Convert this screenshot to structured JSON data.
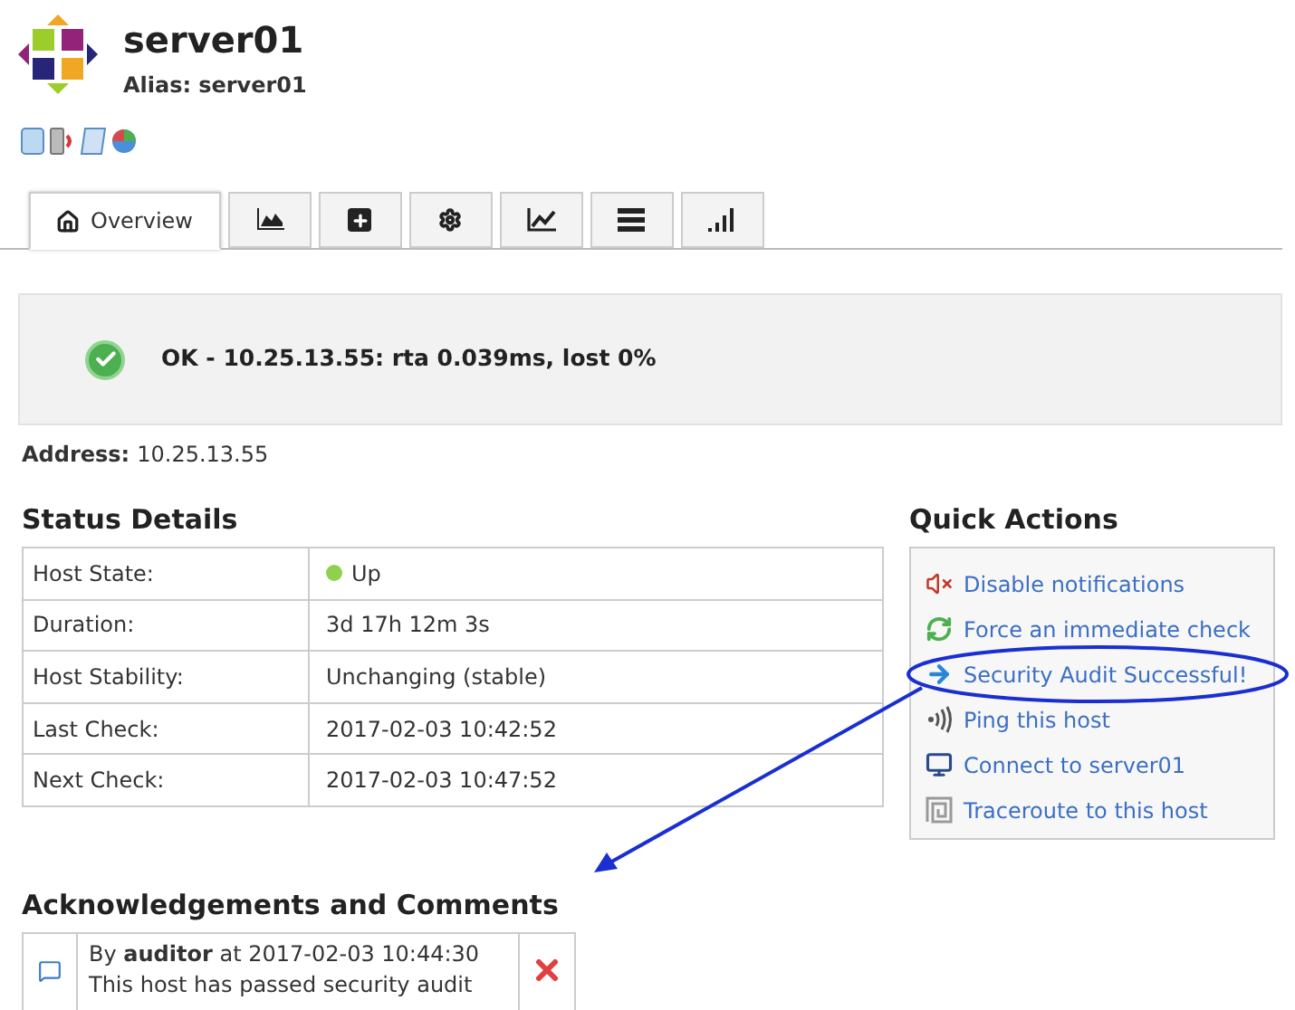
{
  "host": {
    "name": "server01",
    "alias_label": "Alias:",
    "alias": "server01"
  },
  "tabs": [
    {
      "kind": "overview",
      "label": "Overview",
      "selected": true
    },
    {
      "kind": "area",
      "selected": false
    },
    {
      "kind": "plus",
      "selected": false
    },
    {
      "kind": "gear",
      "selected": false
    },
    {
      "kind": "trend",
      "selected": false
    },
    {
      "kind": "list",
      "selected": false
    },
    {
      "kind": "bars",
      "selected": false
    }
  ],
  "status": {
    "ok": true,
    "text": "OK - 10.25.13.55: rta 0.039ms, lost 0%"
  },
  "address": {
    "label": "Address:",
    "value": "10.25.13.55"
  },
  "status_details": {
    "title": "Status Details",
    "rows": [
      {
        "label": "Host State:",
        "value": "Up",
        "kind": "state",
        "color": "#8fd14f"
      },
      {
        "label": "Duration:",
        "value": "3d 17h 12m 3s",
        "kind": "text"
      },
      {
        "label": "Host Stability:",
        "value": "Unchanging (stable)",
        "kind": "text"
      },
      {
        "label": "Last Check:",
        "value": "2017-02-03 10:42:52",
        "kind": "text"
      },
      {
        "label": "Next Check:",
        "value": "2017-02-03 10:47:52",
        "kind": "text"
      }
    ]
  },
  "quick_actions": {
    "title": "Quick Actions",
    "items": [
      {
        "kind": "mute",
        "label": "Disable notifications",
        "circled": false
      },
      {
        "kind": "refresh",
        "label": "Force an immediate check",
        "circled": false
      },
      {
        "kind": "arrow",
        "label": "Security Audit Successful!",
        "circled": true
      },
      {
        "kind": "ping",
        "label": "Ping this host",
        "circled": false
      },
      {
        "kind": "connect",
        "label": "Connect to server01",
        "circled": false
      },
      {
        "kind": "trace",
        "label": "Traceroute to this host",
        "circled": false
      }
    ]
  },
  "comments": {
    "title": "Acknowledgements and Comments",
    "items": [
      {
        "text": "By **auditor** at 2017-02-03 10:44:30",
        "body": "This host has passed security audit"
      }
    ]
  }
}
